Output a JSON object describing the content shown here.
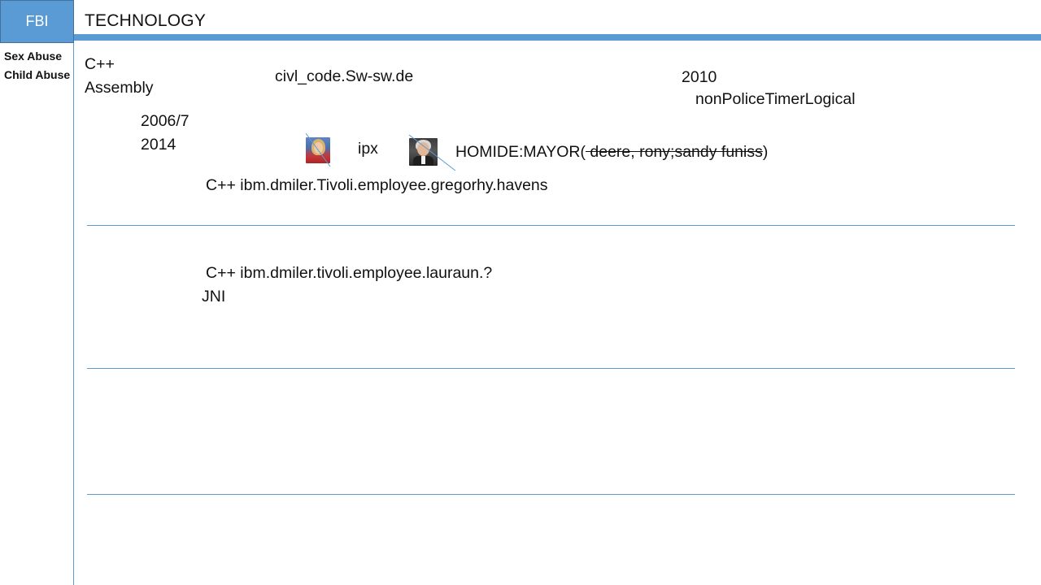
{
  "header": {
    "badge": "FBI",
    "title": "TECHNOLOGY"
  },
  "sidebar": {
    "labels": [
      "Sex Abuse",
      "Child Abuse"
    ]
  },
  "content": {
    "lang1": "C++",
    "lang2": "Assembly",
    "domain": "civl_code.Sw-sw.de",
    "year_2010": "2010",
    "logical": "nonPoliceTimerLogical",
    "date_range1": "2006/7",
    "date_range2": "2014",
    "protocol": "ipx",
    "homicide_prefix": "HOMIDE:MAYOR(",
    "homicide_struck": " deere, rony;sandy funiss",
    "homicide_suffix": ")",
    "line1": "C++ ibm.dmiler.Tivoli.employee.gregorhy.havens",
    "line2": "C++ ibm.dmiler.tivoli.employee.lauraun.?",
    "jni": "JNI"
  },
  "colors": {
    "accent": "#5b9bd5",
    "accent_border": "#41719c",
    "text": "#111111"
  },
  "icons": {
    "photo_1": "person-portrait-woman-icon",
    "photo_2": "person-portrait-man-icon"
  }
}
